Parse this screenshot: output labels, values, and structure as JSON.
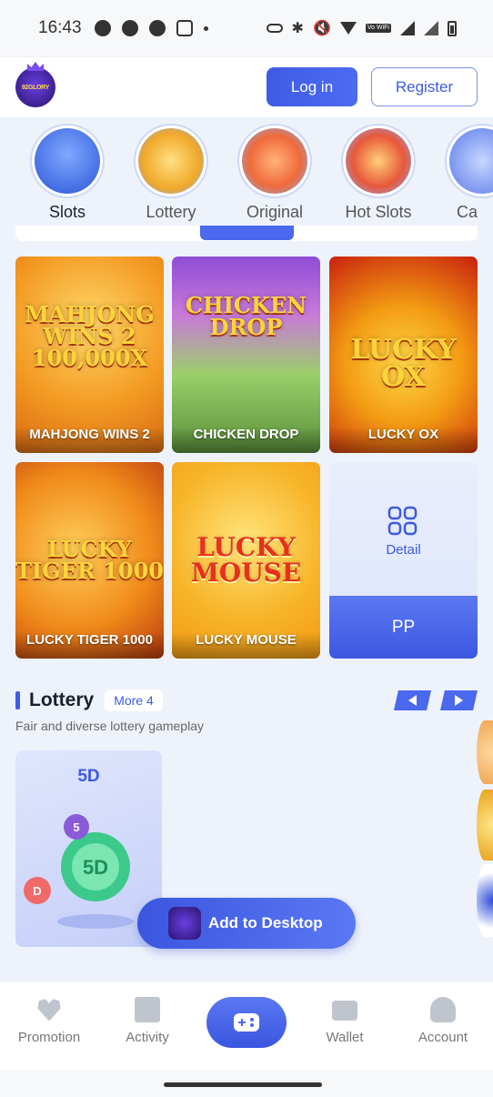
{
  "status_bar": {
    "time": "16:43",
    "network_label": "Vo WiFi"
  },
  "header": {
    "logo_text": "92GLORY",
    "login_label": "Log in",
    "register_label": "Register"
  },
  "categories": [
    {
      "label": "Slots",
      "active": true
    },
    {
      "label": "Lottery"
    },
    {
      "label": "Original"
    },
    {
      "label": "Hot Slots"
    },
    {
      "label": "Ca"
    }
  ],
  "games": [
    {
      "title": "MAHJONG WINS 2",
      "art_text": "MAHJONG WINS 2 100,000X"
    },
    {
      "title": "CHICKEN DROP",
      "art_text": "CHICKEN DROP"
    },
    {
      "title": "LUCKY OX",
      "art_text": "LUCKY OX"
    },
    {
      "title": "LUCKY TIGER 1000",
      "art_text": "LUCKY TIGER 1000"
    },
    {
      "title": "LUCKY MOUSE",
      "art_text": "LUCKY MOUSE"
    }
  ],
  "detail_tile": {
    "detail_label": "Detail",
    "provider": "PP"
  },
  "lottery_section": {
    "title": "Lottery",
    "more_label": "More 4",
    "description": "Fair and diverse lottery gameplay",
    "card_name": "5D",
    "ball_label": "5D",
    "small_ball_1": "5",
    "small_ball_2": "D"
  },
  "add_to_desktop": {
    "label": "Add to Desktop"
  },
  "bottom_nav": [
    {
      "label": "Promotion",
      "icon": "promotion-icon"
    },
    {
      "label": "Activity",
      "icon": "gift-icon"
    },
    {
      "label": "",
      "icon": "gamepad-icon"
    },
    {
      "label": "Wallet",
      "icon": "wallet-icon"
    },
    {
      "label": "Account",
      "icon": "account-icon"
    }
  ]
}
